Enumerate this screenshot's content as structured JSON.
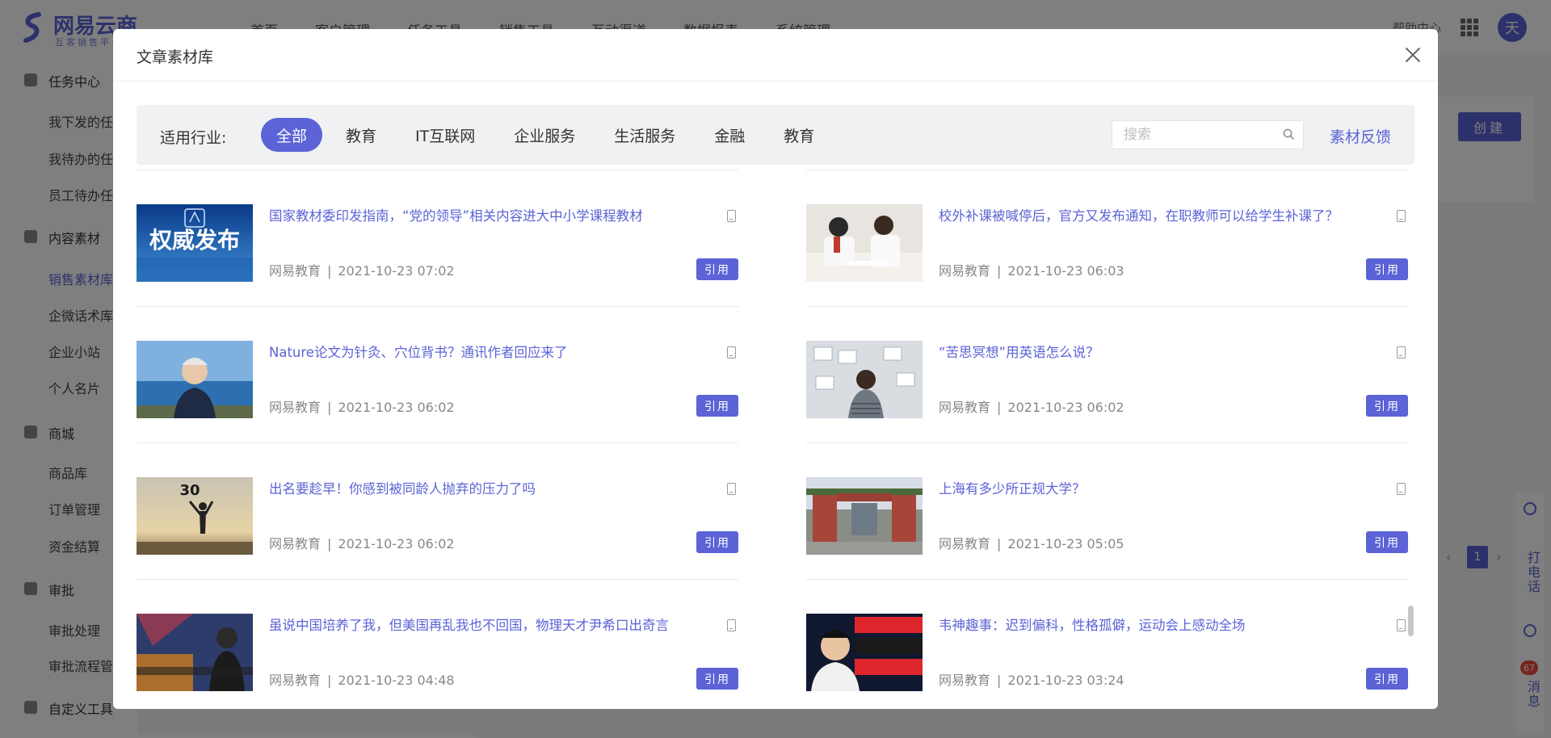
{
  "app": {
    "logo_title": "网易云商",
    "logo_sub": "互客销售平台",
    "nav": [
      "首页",
      "客户管理",
      "任务工具",
      "销售工具",
      "互动渠道",
      "数据报表",
      "系统管理"
    ],
    "top_link": "帮助中心",
    "avatar": "天",
    "sidebar": [
      {
        "label": "任务中心",
        "group": true
      },
      {
        "label": "我下发的任务",
        "group": false
      },
      {
        "label": "我待办的任务",
        "group": false
      },
      {
        "label": "员工待办任务",
        "group": false
      },
      {
        "label": "内容素材",
        "group": true
      },
      {
        "label": "销售素材库",
        "group": false,
        "active": true
      },
      {
        "label": "企微话术库",
        "group": false
      },
      {
        "label": "企业小站",
        "group": false
      },
      {
        "label": "个人名片",
        "group": false
      },
      {
        "label": "商城",
        "group": true
      },
      {
        "label": "商品库",
        "group": false
      },
      {
        "label": "订单管理",
        "group": false
      },
      {
        "label": "资金结算",
        "group": false
      },
      {
        "label": "审批",
        "group": true
      },
      {
        "label": "审批处理",
        "group": false
      },
      {
        "label": "审批流程管理",
        "group": false
      },
      {
        "label": "自定义工具",
        "group": true
      }
    ],
    "create_label": "创建",
    "page_number": "1",
    "rail": {
      "call": "打电话",
      "messages": "消息",
      "badge": "67"
    }
  },
  "modal": {
    "title": "文章素材库",
    "filter_label": "适用行业:",
    "industries": [
      {
        "label": "全部",
        "active": true
      },
      {
        "label": "教育",
        "active": false
      },
      {
        "label": "IT互联网",
        "active": false
      },
      {
        "label": "企业服务",
        "active": false
      },
      {
        "label": "生活服务",
        "active": false
      },
      {
        "label": "金融",
        "active": false
      },
      {
        "label": "教育",
        "active": false
      }
    ],
    "search_placeholder": "搜索",
    "search_value": "",
    "feedback_label": "素材反馈",
    "quote_label": "引用",
    "articles": [
      {
        "title": "国家教材委印发指南，“党的领导”相关内容进大中小学课程教材",
        "source": "网易教育",
        "time": "2021-10-23 07:02",
        "thumb": "authority-release",
        "thumb_text": "权威发布"
      },
      {
        "title": "校外补课被喊停后，官方又发布通知，在职教师可以给学生补课了？",
        "source": "网易教育",
        "time": "2021-10-23 06:03",
        "thumb": "tutoring-students"
      },
      {
        "title": "Nature论文为针灸、穴位背书？通讯作者回应来了",
        "source": "网易教育",
        "time": "2021-10-23 06:02",
        "thumb": "man-by-sea"
      },
      {
        "title": "“苦思冥想”用英语怎么说？",
        "source": "网易教育",
        "time": "2021-10-23 06:02",
        "thumb": "thinking-at-wall"
      },
      {
        "title": "出名要趁早！你感到被同龄人抛弃的压力了吗",
        "source": "网易教育",
        "time": "2021-10-23 06:02",
        "thumb": "sunset-30",
        "thumb_text": "30"
      },
      {
        "title": "上海有多少所正规大学？",
        "source": "网易教育",
        "time": "2021-10-23 05:05",
        "thumb": "university-gate"
      },
      {
        "title": "虽说中国培养了我，但美国再乱我也不回国，物理天才尹希口出奇言",
        "source": "网易教育",
        "time": "2021-10-23 04:48",
        "thumb": "physicist-flag"
      },
      {
        "title": "韦神趣事：迟到偏科，性格孤僻，运动会上感动全场",
        "source": "网易教育",
        "time": "2021-10-23 03:24",
        "thumb": "wei-shen"
      }
    ]
  }
}
